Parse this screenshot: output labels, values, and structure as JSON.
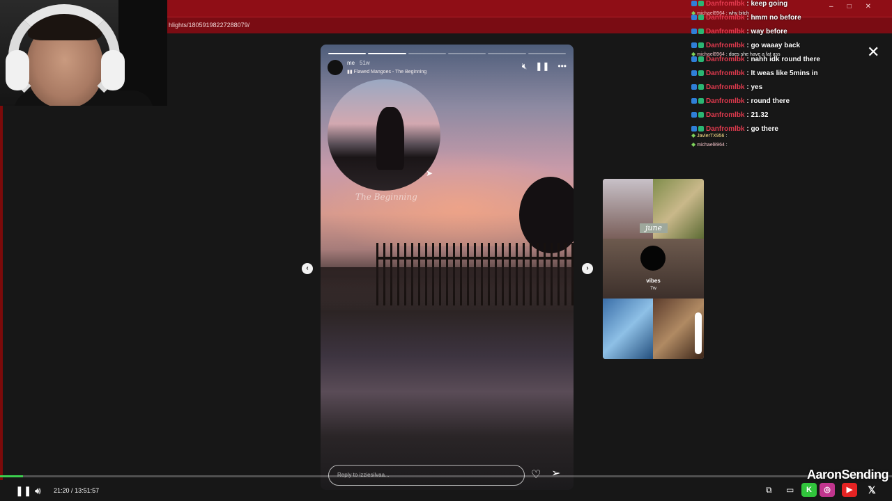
{
  "browser": {
    "url": "hlights/18059198227288079/",
    "controls": [
      "–",
      "□",
      "✕"
    ]
  },
  "story": {
    "username": "me",
    "time_ago": "51w",
    "song": "Flawed Mangoes - The Beginning",
    "music_caption": "The Beginning",
    "reply_placeholder": "Reply to izziesilvaa...",
    "progress_segments": 6,
    "progress_active_segment": 2
  },
  "next_preview": {
    "sticker_text": "june",
    "username": "vibes",
    "time_ago": "7w"
  },
  "chat": [
    {
      "user": "Danfromlbk",
      "msg": "keep going",
      "style": "main"
    },
    {
      "user": "michael8964",
      "msg": "why bitch",
      "style": "minor"
    },
    {
      "user": "Danfromlbk",
      "msg": "hmm no before",
      "style": "main"
    },
    {
      "user": "Danfromlbk",
      "msg": "way before",
      "style": "main"
    },
    {
      "user": "Danfromlbk",
      "msg": "go waaay back",
      "style": "main"
    },
    {
      "user": "michael8964",
      "msg": "does she have a fat ass",
      "style": "minor"
    },
    {
      "user": "Danfromlbk",
      "msg": "nahh idk round there",
      "style": "main"
    },
    {
      "user": "Danfromlbk",
      "msg": "It weas like 5mins in",
      "style": "main"
    },
    {
      "user": "Danfromlbk",
      "msg": "yes",
      "style": "main"
    },
    {
      "user": "Danfromlbk",
      "msg": "round there",
      "style": "main"
    },
    {
      "user": "Danfromlbk",
      "msg": "21.32",
      "style": "main"
    },
    {
      "user": "Danfromlbk",
      "msg": "go there",
      "style": "main"
    },
    {
      "user": "JavierTX956",
      "msg": "",
      "style": "minor"
    },
    {
      "user": "michael8964",
      "msg": "",
      "style": "minor"
    }
  ],
  "player": {
    "current_time": "21:20",
    "separator": "/",
    "total_time": "13:51:57",
    "progress_fraction": 0.026
  },
  "branding": {
    "name": "AaronSending"
  },
  "icons": {
    "close": "close-icon",
    "mute": "speaker-muted-icon",
    "pause": "pause-icon",
    "more": "more-icon"
  },
  "colors": {
    "browser_bar": "#8f0e16",
    "chat_user": "#e23a4e",
    "progress_green": "#3ccf4e"
  }
}
